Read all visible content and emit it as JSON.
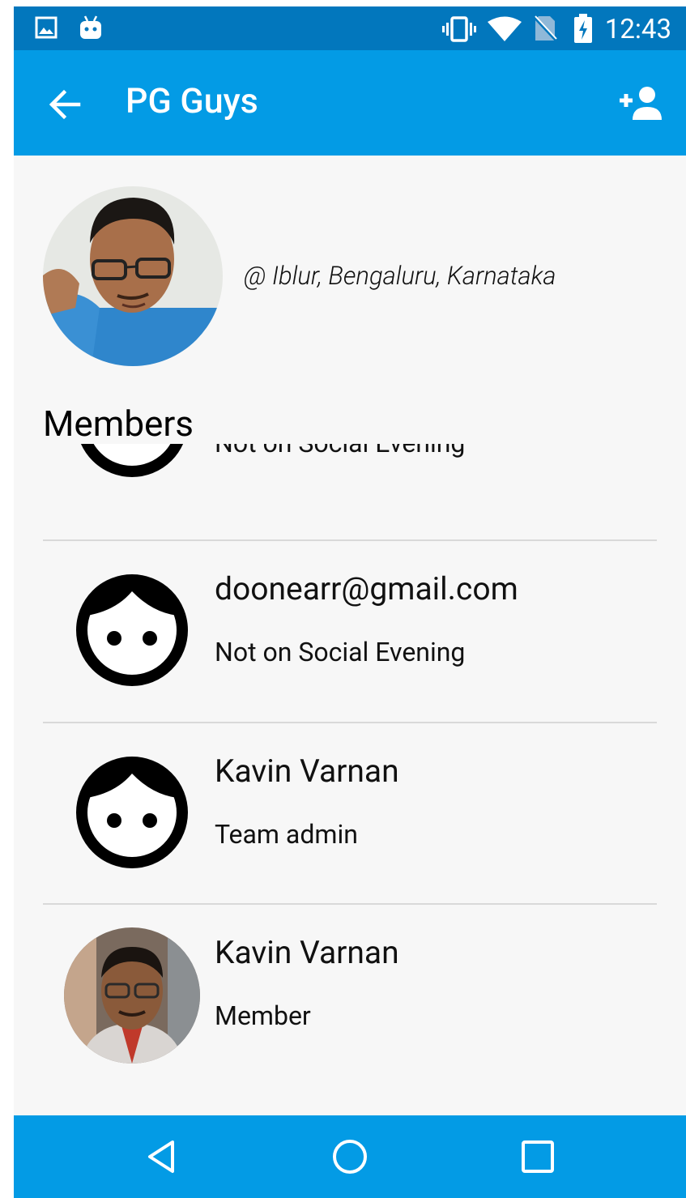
{
  "status_bar": {
    "time": "12:43"
  },
  "app_bar": {
    "title": "PG Guys"
  },
  "profile": {
    "location": "@ Iblur, Bengaluru, Karnataka"
  },
  "members_heading": "Members",
  "members": [
    {
      "name": "",
      "status": "Not on Social Evening"
    },
    {
      "name": "doonearr@gmail.com",
      "status": "Not on Social Evening"
    },
    {
      "name": "Kavin Varnan",
      "status": "Team admin"
    },
    {
      "name": "Kavin Varnan",
      "status": "Member"
    }
  ],
  "colors": {
    "status_bar": "#0277bd",
    "app_bar": "#039be5",
    "nav_bar": "#039be5",
    "background": "#f7f7f7"
  },
  "icons": [
    "image-icon",
    "android-icon",
    "vibrate-icon",
    "wifi-icon",
    "no-sim-icon",
    "battery-charging-icon",
    "back-arrow-icon",
    "add-person-icon",
    "face-icon",
    "nav-back-icon",
    "nav-home-icon",
    "nav-recents-icon"
  ]
}
